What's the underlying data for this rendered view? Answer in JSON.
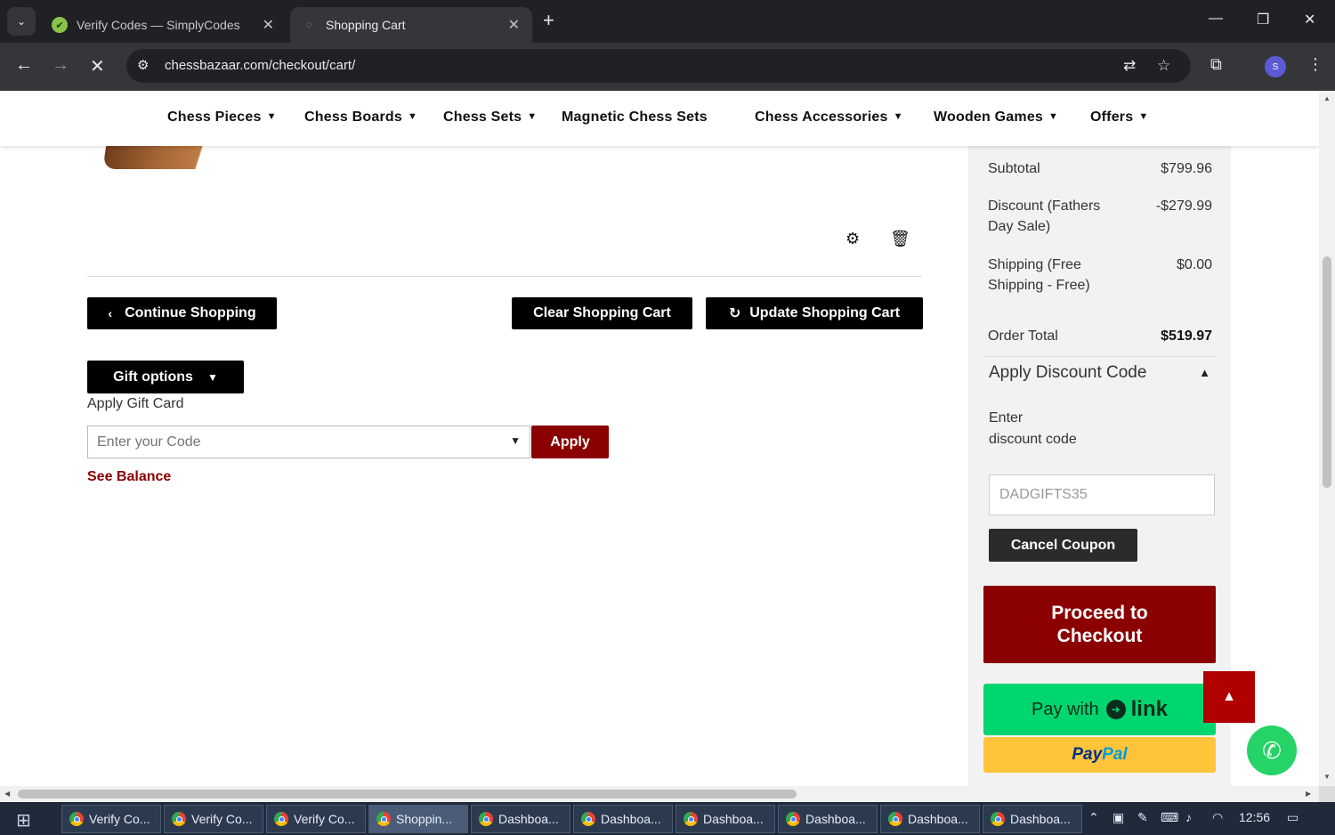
{
  "browser": {
    "tabs": [
      {
        "title": "Verify Codes — SimplyCodes",
        "close": "✕"
      },
      {
        "title": "Shopping Cart",
        "close": "✕"
      }
    ],
    "url": "chessbazaar.com/checkout/cart/"
  },
  "nav": {
    "items": [
      "Chess Pieces",
      "Chess Boards",
      "Chess Sets",
      "Magnetic Chess Sets",
      "Chess Accessories",
      "Wooden Games",
      "Offers"
    ]
  },
  "cart": {
    "continue_label": "Continue Shopping",
    "clear_label": "Clear Shopping Cart",
    "update_label": "Update Shopping Cart",
    "gift_options_label": "Gift options",
    "apply_gift_card_label": "Apply Gift Card",
    "gift_code_placeholder": "Enter your Code",
    "apply_label": "Apply",
    "see_balance_label": "See Balance"
  },
  "summary": {
    "subtotal_label": "Subtotal",
    "subtotal_value": "$799.96",
    "discount_label": "Discount (Fathers Day Sale)",
    "discount_value": "-$279.99",
    "shipping_label": "Shipping (Free Shipping - Free)",
    "shipping_value": "$0.00",
    "order_total_label": "Order Total",
    "order_total_value": "$519.97",
    "apply_discount_title": "Apply Discount Code",
    "discount_code_label": "Enter discount code",
    "discount_code_value": "DADGIFTS35",
    "cancel_coupon_label": "Cancel Coupon",
    "checkout_label": "Proceed to Checkout",
    "link_pay_prefix": "Pay with",
    "link_pay_brand": "link",
    "paypal_part1": "Pay",
    "paypal_part2": "Pal"
  },
  "taskbar": {
    "apps": [
      {
        "label": "Verify Co..."
      },
      {
        "label": "Verify Co..."
      },
      {
        "label": "Verify Co..."
      },
      {
        "label": "Shoppin...",
        "active": true
      },
      {
        "label": "Dashboa..."
      },
      {
        "label": "Dashboa..."
      },
      {
        "label": "Dashboa..."
      },
      {
        "label": "Dashboa..."
      },
      {
        "label": "Dashboa..."
      },
      {
        "label": "Dashboa..."
      }
    ],
    "clock": "12:56"
  }
}
